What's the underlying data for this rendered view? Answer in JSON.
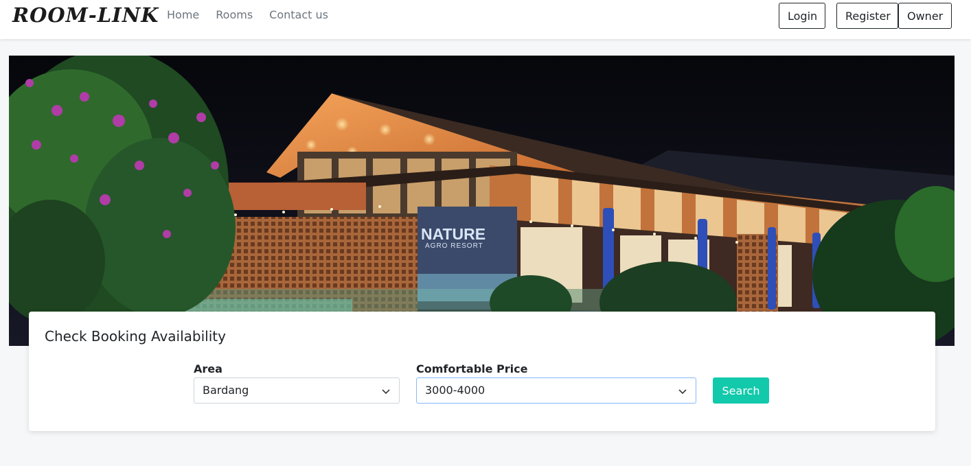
{
  "navbar": {
    "brand": "ROOM-LINK",
    "links": [
      "Home",
      "Rooms",
      "Contact us"
    ],
    "login_label": "Login",
    "register_label": "Register",
    "owner_label": "Owner"
  },
  "hero": {
    "sign_line1": "NATURE",
    "sign_line2": "AGRO RESORT"
  },
  "booking": {
    "title": "Check Booking Availability",
    "area_label": "Area",
    "area_value": "Bardang",
    "price_label": "Comfortable Price",
    "price_value": "3000-4000",
    "search_label": "Search"
  },
  "colors": {
    "accent": "#13c9ab",
    "focus_border": "#86b7fe"
  }
}
